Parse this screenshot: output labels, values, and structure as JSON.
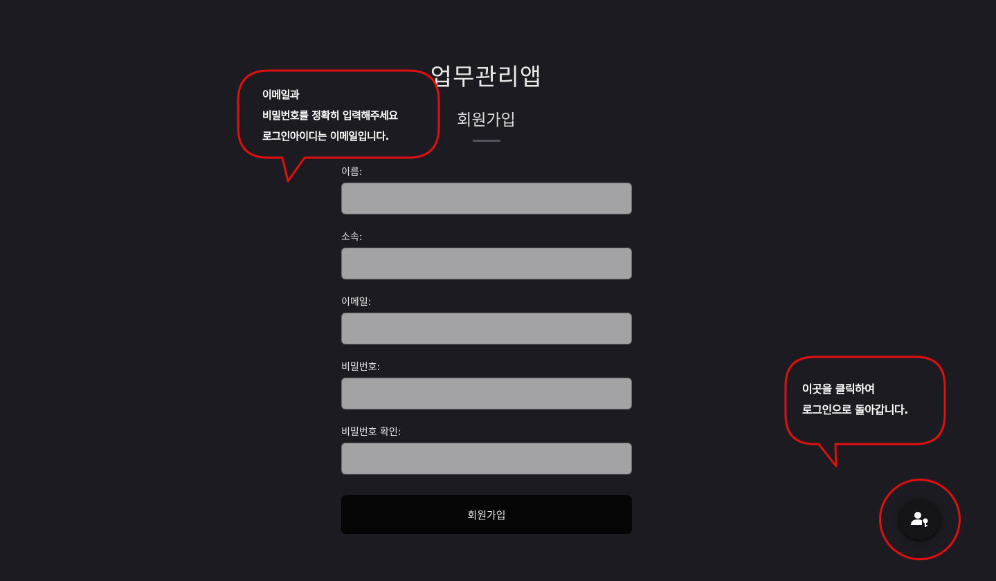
{
  "header": {
    "app_title": "업무관리앱",
    "page_title": "회원가입"
  },
  "form": {
    "fields": [
      {
        "label": "이름:",
        "value": ""
      },
      {
        "label": "소속:",
        "value": ""
      },
      {
        "label": "이메일:",
        "value": ""
      },
      {
        "label": "비밀번호:",
        "value": ""
      },
      {
        "label": "비밀번호 확인:",
        "value": ""
      }
    ],
    "submit_label": "회원가입"
  },
  "tooltips": {
    "email_hint": {
      "lines": [
        "이메일과",
        "비밀번호를 정확히 입력해주세요",
        "로그인아이디는 이메일입니다."
      ]
    },
    "login_hint": {
      "lines": [
        "이곳을 클릭하여",
        "로그인으로 돌아갑니다."
      ]
    }
  },
  "fab": {
    "icon": "person-key-icon"
  },
  "colors": {
    "background": "#1c1b21",
    "input_background": "#a3a3a5",
    "button_background": "#060606",
    "annotation_red": "#e10f0f"
  }
}
